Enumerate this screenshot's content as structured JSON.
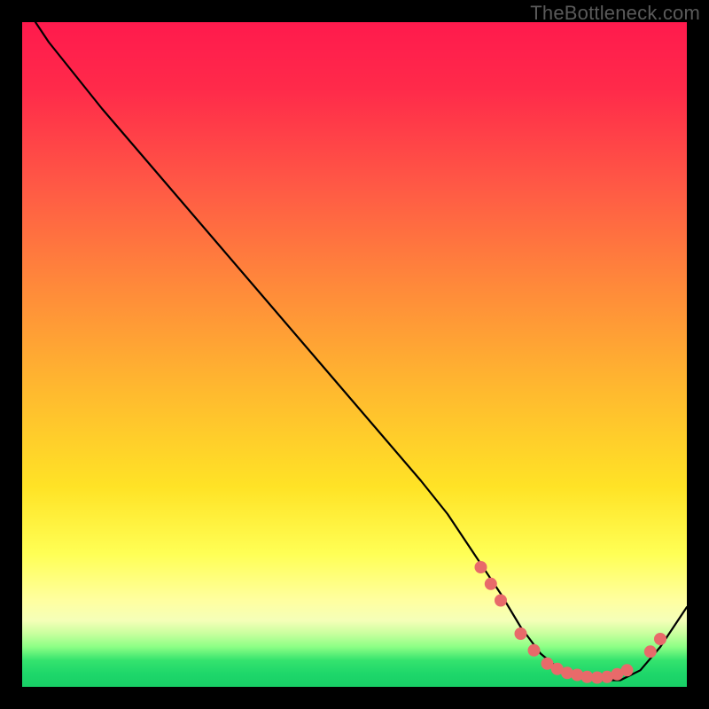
{
  "watermark": "TheBottleneck.com",
  "colors": {
    "gradient_top": "#ff1a4d",
    "gradient_mid": "#ffe326",
    "gradient_bottom": "#18cf66",
    "curve": "#000000",
    "dots": "#e86a6a",
    "frame": "#000000"
  },
  "chart_data": {
    "type": "line",
    "title": "",
    "xlabel": "",
    "ylabel": "",
    "xlim": [
      0,
      100
    ],
    "ylim": [
      0,
      100
    ],
    "grid": false,
    "legend": false,
    "series": [
      {
        "name": "bottleneck-curve",
        "x": [
          2,
          4,
          8,
          12,
          18,
          24,
          30,
          36,
          42,
          48,
          54,
          60,
          64,
          68,
          72,
          75,
          78,
          81,
          84,
          87,
          90,
          93,
          96,
          100
        ],
        "y": [
          100,
          97,
          92,
          87,
          80,
          73,
          66,
          59,
          52,
          45,
          38,
          31,
          26,
          20,
          14,
          9,
          5,
          2.5,
          1.5,
          1,
          1,
          2.5,
          6,
          12
        ]
      }
    ],
    "marker_cluster": {
      "comment": "red dots highlighting the basin region on the curve",
      "points": [
        {
          "x": 69,
          "y": 18
        },
        {
          "x": 70.5,
          "y": 15.5
        },
        {
          "x": 72,
          "y": 13
        },
        {
          "x": 75,
          "y": 8
        },
        {
          "x": 77,
          "y": 5.5
        },
        {
          "x": 79,
          "y": 3.5
        },
        {
          "x": 80.5,
          "y": 2.7
        },
        {
          "x": 82,
          "y": 2.1
        },
        {
          "x": 83.5,
          "y": 1.8
        },
        {
          "x": 85,
          "y": 1.5
        },
        {
          "x": 86.5,
          "y": 1.4
        },
        {
          "x": 88,
          "y": 1.5
        },
        {
          "x": 89.5,
          "y": 1.9
        },
        {
          "x": 91,
          "y": 2.5
        },
        {
          "x": 94.5,
          "y": 5.3
        },
        {
          "x": 96,
          "y": 7.2
        }
      ],
      "radius": 7
    }
  }
}
